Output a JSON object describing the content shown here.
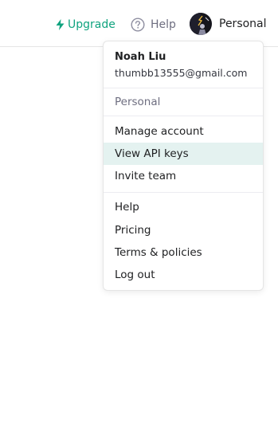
{
  "header": {
    "upgrade_label": "Upgrade",
    "help_label": "Help",
    "account_label": "Personal",
    "accent_color": "#10a37f"
  },
  "menu": {
    "user_name": "Noah Liu",
    "user_email": "thumbb13555@gmail.com",
    "organization": "Personal",
    "account_items": [
      {
        "label": "Manage account",
        "highlighted": false
      },
      {
        "label": "View API keys",
        "highlighted": true
      },
      {
        "label": "Invite team",
        "highlighted": false
      }
    ],
    "general_items": [
      {
        "label": "Help"
      },
      {
        "label": "Pricing"
      },
      {
        "label": "Terms & policies"
      },
      {
        "label": "Log out"
      }
    ]
  }
}
